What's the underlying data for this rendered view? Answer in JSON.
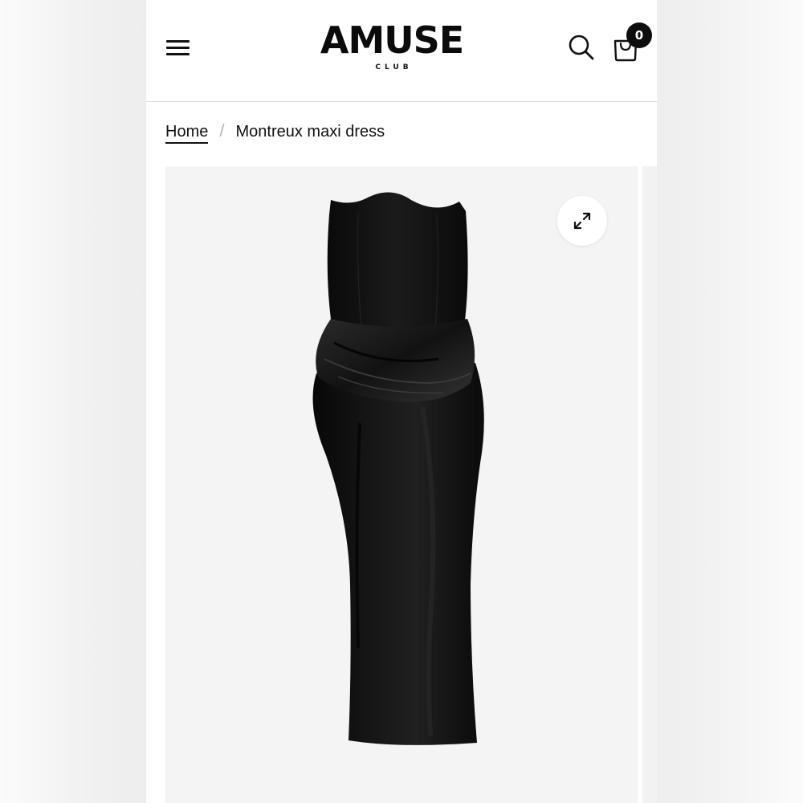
{
  "header": {
    "menu_icon": "hamburger-menu-icon",
    "logo": {
      "main": "AMUSE",
      "sub": "CLUB"
    },
    "search_icon": "search-icon",
    "cart_icon": "shopping-bag-icon",
    "cart_count": "0"
  },
  "breadcrumb": {
    "home": "Home",
    "separator": "/",
    "current": "Montreux maxi dress"
  },
  "gallery": {
    "image_subject": "black strapless satin maxi dress",
    "zoom_icon": "expand-arrows-icon"
  },
  "colors": {
    "text": "#111111",
    "background": "#ffffff",
    "image_background": "#f4f4f4",
    "badge": "#0d0d0d"
  }
}
